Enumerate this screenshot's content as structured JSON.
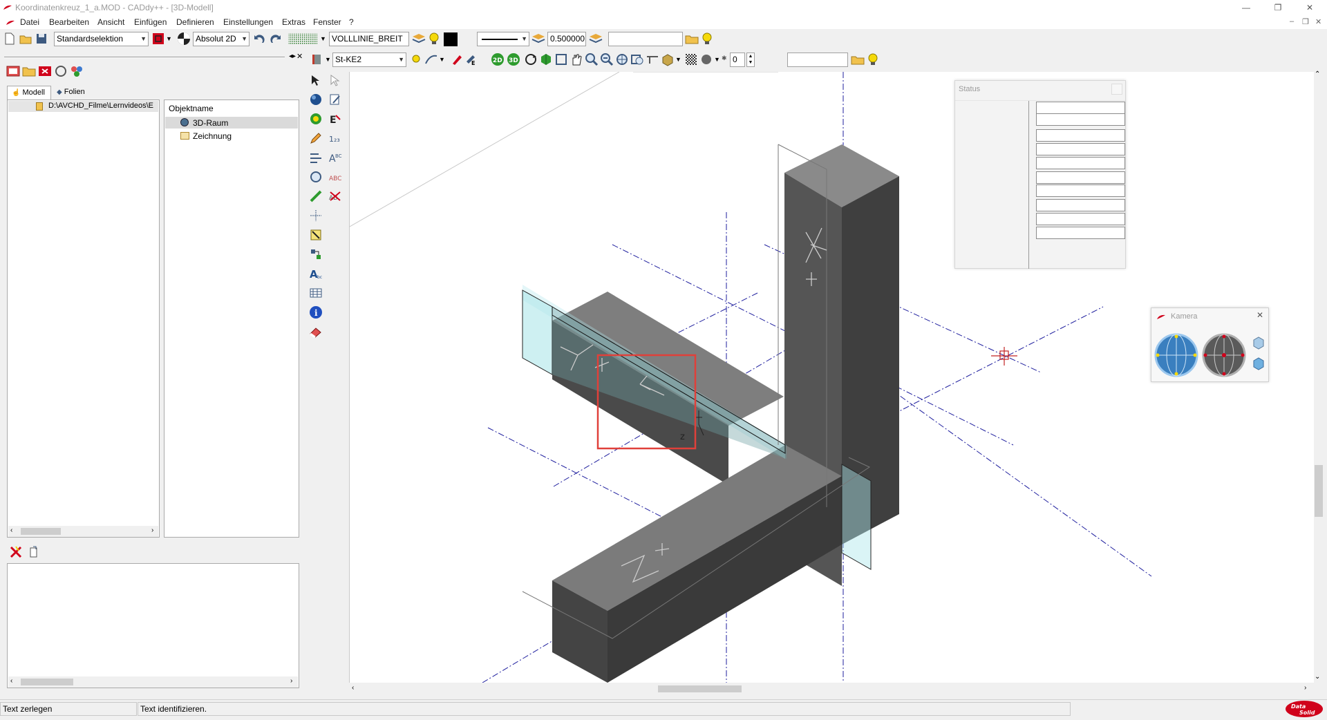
{
  "window": {
    "title": "Koordinatenkreuz_1_a.MOD  -  CADdy++ - [3D-Modell]",
    "minimize": "—",
    "restore": "❐",
    "close": "✕",
    "child_minimize": "–",
    "child_restore": "❐",
    "child_close": "✕"
  },
  "menu": {
    "items": [
      "Datei",
      "Bearbeiten",
      "Ansicht",
      "Einfügen",
      "Definieren",
      "Einstellungen",
      "Extras",
      "Fenster",
      "?"
    ]
  },
  "toolbar1": {
    "selection_mode": "Standardselektion",
    "coordinate_mode": "Absolut 2D",
    "line_type": "VOLLLINIE_BREIT",
    "line_width": "0.500000",
    "empty_field": ""
  },
  "toolbar2": {
    "layer": "St-KE2",
    "button_2d": "2D",
    "button_3d": "3D",
    "number_value": "0",
    "empty_field": ""
  },
  "left_panel": {
    "tabs": [
      "Modell",
      "Folien"
    ],
    "tree_path": "D:\\AVCHD_Filme\\Lernvideos\\E",
    "object_header": "Objektname",
    "objects": [
      {
        "label": "3D-Raum",
        "selected": true
      },
      {
        "label": "Zeichnung",
        "selected": false
      }
    ]
  },
  "canvas": {
    "axis_labels": {
      "x": "X+",
      "y": "Y+",
      "z": "Z+",
      "z_small": "z"
    }
  },
  "status_panel": {
    "title": "Status",
    "rows": [
      "",
      "",
      "",
      "",
      "",
      "",
      "",
      "",
      "",
      ""
    ]
  },
  "camera_panel": {
    "title": "Kamera"
  },
  "statusbar": {
    "left": "Text zerlegen",
    "right": "Text identifizieren.",
    "logo": "Data Solid"
  },
  "colors": {
    "accent_red": "#d0021b",
    "selection_box": "#e0403a",
    "axis_blue": "#2a2ad0",
    "plane_cyan": "#aee6ea"
  }
}
